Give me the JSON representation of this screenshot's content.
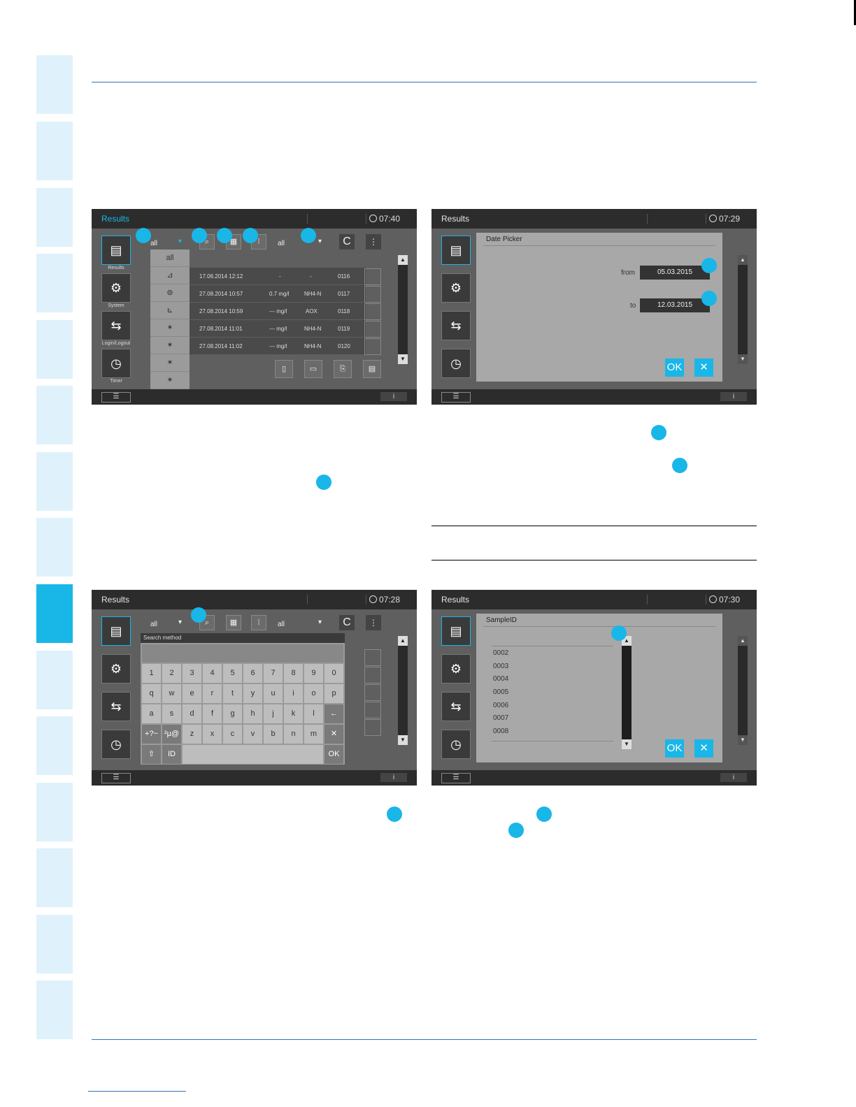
{
  "screens": {
    "results": {
      "title": "Results",
      "time": "07:40",
      "side_results": "Results",
      "side_system": "System",
      "side_login": "Login/Logout",
      "side_timer": "Timer",
      "filter1": "all",
      "filter2": "all",
      "btn_c": "C",
      "btn_info": "i",
      "dropdown_first": "all",
      "rows": [
        {
          "date": "17.06.2014 12:12",
          "value": "-",
          "param": "-",
          "id": "0116"
        },
        {
          "date": "27.08.2014 10:57",
          "value": "0.7 mg/l",
          "param": "NH4-N",
          "id": "0117"
        },
        {
          "date": "27.08.2014 10:59",
          "value": "--- mg/l",
          "param": "AOX",
          "id": "0118"
        },
        {
          "date": "27.08.2014 11:01",
          "value": "--- mg/l",
          "param": "NH4-N",
          "id": "0119"
        },
        {
          "date": "27.08.2014 11:02",
          "value": "--- mg/l",
          "param": "NH4-N",
          "id": "0120"
        }
      ]
    },
    "date_picker": {
      "title": "Results",
      "time": "07:29",
      "panel_title": "Date Picker",
      "from_label": "from",
      "from_value": "05.03.2015",
      "to_label": "to",
      "to_value": "12.03.2015",
      "ok": "OK",
      "btn_info": "i"
    },
    "search": {
      "title": "Results",
      "time": "07:28",
      "filter1": "all",
      "filter2": "all",
      "btn_c": "C",
      "panel_title": "Search method",
      "row1": [
        "1",
        "2",
        "3",
        "4",
        "5",
        "6",
        "7",
        "8",
        "9",
        "0"
      ],
      "row2": [
        "q",
        "w",
        "e",
        "r",
        "t",
        "y",
        "u",
        "i",
        "o",
        "p"
      ],
      "row3": [
        "a",
        "s",
        "d",
        "f",
        "g",
        "h",
        "j",
        "k",
        "l"
      ],
      "row4": [
        "z",
        "x",
        "c",
        "v",
        "b",
        "n",
        "m"
      ],
      "sym1": "+?~",
      "sym2": "²µ@",
      "id_key": "ID",
      "ok": "OK",
      "btn_info": "i"
    },
    "sampleid": {
      "title": "Results",
      "time": "07:30",
      "panel_title": "SampleID",
      "items": [
        "0002",
        "0003",
        "0004",
        "0005",
        "0006",
        "0007",
        "0008"
      ],
      "ok": "OK",
      "btn_info": "i"
    }
  }
}
